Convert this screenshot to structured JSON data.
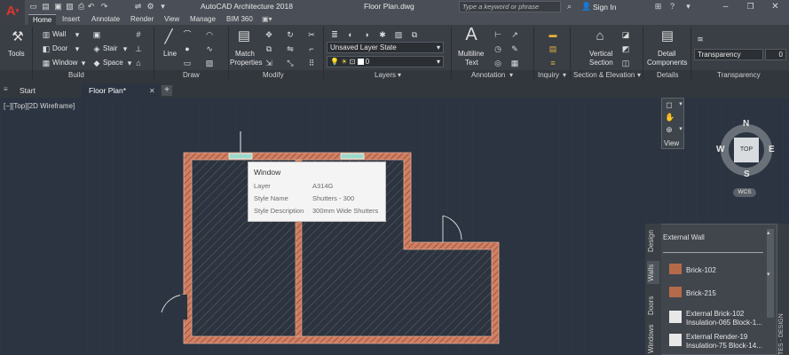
{
  "titlebar": {
    "app_title": "AutoCAD Architecture 2018",
    "file_name": "Floor Plan.dwg",
    "search_placeholder": "Type a keyword or phrase",
    "sign_in": "Sign In"
  },
  "ribbon_tabs": [
    "Home",
    "Insert",
    "Annotate",
    "Render",
    "View",
    "Manage",
    "BIM 360"
  ],
  "ribbon": {
    "tools_label": "Tools",
    "build": {
      "wall": "Wall",
      "door": "Door",
      "window": "Window",
      "stair": "Stair",
      "space": "Space",
      "title": "Build"
    },
    "draw": {
      "line": "Line",
      "title": "Draw"
    },
    "modify": {
      "match_properties_1": "Match",
      "match_properties_2": "Properties",
      "title": "Modify"
    },
    "layers": {
      "layer_state": "Unsaved Layer State",
      "current_layer": "0",
      "title": "Layers"
    },
    "annotation": {
      "multiline_1": "Multiline",
      "multiline_2": "Text",
      "title": "Annotation"
    },
    "inquiry": {
      "title": "Inquiry"
    },
    "section": {
      "vertical_1": "Vertical",
      "vertical_2": "Section",
      "title": "Section & Elevation"
    },
    "details": {
      "detail_1": "Detail",
      "detail_2": "Components",
      "title": "Details"
    },
    "transparency": {
      "label": "Transparency",
      "value": "0",
      "title": "Transparency"
    }
  },
  "doc_tabs": [
    "Start",
    "Floor Plan*"
  ],
  "viewport": {
    "label": "[−][Top][2D Wireframe]"
  },
  "viewcube": {
    "n": "N",
    "s": "S",
    "e": "E",
    "w": "W",
    "top": "TOP",
    "wcs": "WCS",
    "view_label": "View"
  },
  "tooltip": {
    "title": "Window",
    "rows": [
      {
        "key": "Layer",
        "value": "A314G"
      },
      {
        "key": "Style Name",
        "value": "Shutters - 300"
      },
      {
        "key": "Style Description",
        "value": "300mm Wide Shutters"
      }
    ]
  },
  "palette": {
    "tabs": [
      "Design",
      "Walls",
      "Doors",
      "Windows"
    ],
    "header": "External Wall",
    "items": [
      {
        "line1": "Brick-102",
        "line2": ""
      },
      {
        "line1": "Brick-215",
        "line2": ""
      },
      {
        "line1": "External Brick-102",
        "line2": "Insulation-065 Block-1..."
      },
      {
        "line1": "External Render-19",
        "line2": "Insulation-75 Block-14..."
      }
    ],
    "side_label": "TES - DESIGN"
  },
  "colors": {
    "canvas": "#2b3440",
    "wall_fill": "#d98a6a",
    "hatch": "#9a7f73",
    "accent_red": "#e0342f"
  }
}
